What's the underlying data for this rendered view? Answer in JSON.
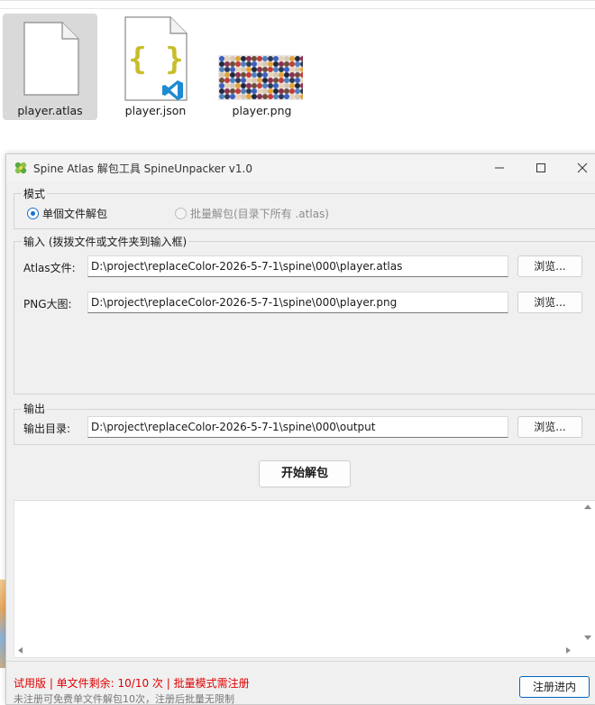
{
  "explorer": {
    "files": [
      {
        "name": "player.atlas",
        "icon": "document-icon",
        "selected": true
      },
      {
        "name": "player.json",
        "icon": "json-vscode-icon",
        "selected": false
      },
      {
        "name": "player.png",
        "icon": "image-thumbnail",
        "selected": false
      }
    ]
  },
  "window": {
    "title": "Spine Atlas 解包工具 SpineUnpacker v1.0",
    "controls": {
      "minimize": "minimize-icon",
      "maximize": "maximize-icon",
      "close": "close-icon"
    }
  },
  "mode": {
    "legend": "模式",
    "options": [
      {
        "label": "单個文件解包",
        "checked": true,
        "enabled": true
      },
      {
        "label": "批量解包(目录下所有 .atlas)",
        "checked": false,
        "enabled": false
      }
    ]
  },
  "input": {
    "legend": "输入 (拨拨文件或文件夹到输入框)",
    "atlas_label": "Atlas文件:",
    "atlas_value": "D:\\project\\replaceColor-2026-5-7-1\\spine\\000\\player.atlas",
    "png_label": "PNG大图:",
    "png_value": "D:\\project\\replaceColor-2026-5-7-1\\spine\\000\\player.png",
    "browse_label": "浏览..."
  },
  "output": {
    "legend": "输出",
    "dir_label": "输出目录:",
    "dir_value": "D:\\project\\replaceColor-2026-5-7-1\\spine\\000\\output",
    "browse_label": "浏览..."
  },
  "actions": {
    "start_label": "开始解包"
  },
  "status": {
    "main": "试用版 | 单文件剩余: 10/10 次 | 批量模式需注册",
    "sub": "未注册可免费单文件解包10次，注册后批量无限制",
    "register_label": "注册进内"
  },
  "colors": {
    "accent": "#1a6fd0",
    "status_red": "#e00000",
    "register_border": "#0067c0"
  }
}
